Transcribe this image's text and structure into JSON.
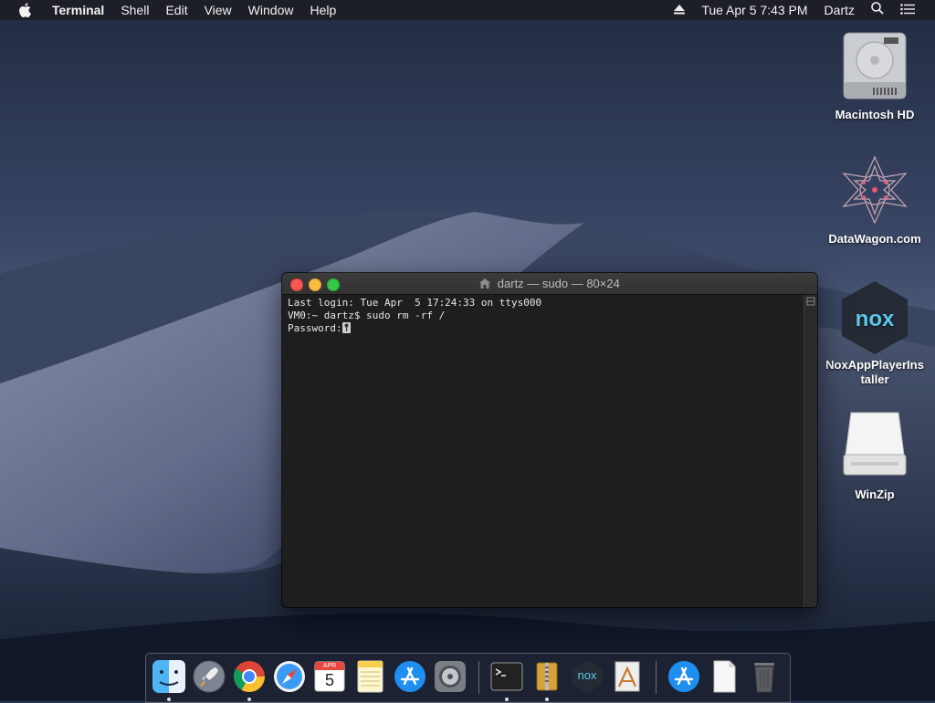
{
  "menubar": {
    "app_name": "Terminal",
    "menus": [
      "Shell",
      "Edit",
      "View",
      "Window",
      "Help"
    ],
    "datetime": "Tue Apr 5  7:43 PM",
    "user": "Dartz"
  },
  "desktop_icons": [
    {
      "label": "Macintosh HD",
      "icon": "hard-drive-icon"
    },
    {
      "label": "DataWagon.com",
      "icon": "datawagon-icon"
    },
    {
      "label": "NoxAppPlayerIns taller",
      "icon": "nox-icon"
    },
    {
      "label": "WinZip",
      "icon": "disk-image-icon"
    }
  ],
  "terminal": {
    "title": "dartz — sudo — 80×24",
    "lines": [
      "Last login: Tue Apr  5 17:24:33 on ttys000",
      "VM0:~ dartz$ sudo rm -rf /",
      "Password:"
    ]
  },
  "dock": {
    "apps": [
      "Finder",
      "Launchpad",
      "Chrome",
      "Safari",
      "Calendar",
      "Notes",
      "App Store",
      "System Preferences",
      "Terminal",
      "Archive Utility",
      "Nox",
      "Script Editor",
      "App Store Downloads",
      "Documents",
      "Trash"
    ],
    "calendar_month": "APR",
    "calendar_day": "5",
    "nox_text": "nox"
  },
  "colors": {
    "close": "#fc5753",
    "minimize": "#fdbc40",
    "maximize": "#33c748"
  }
}
